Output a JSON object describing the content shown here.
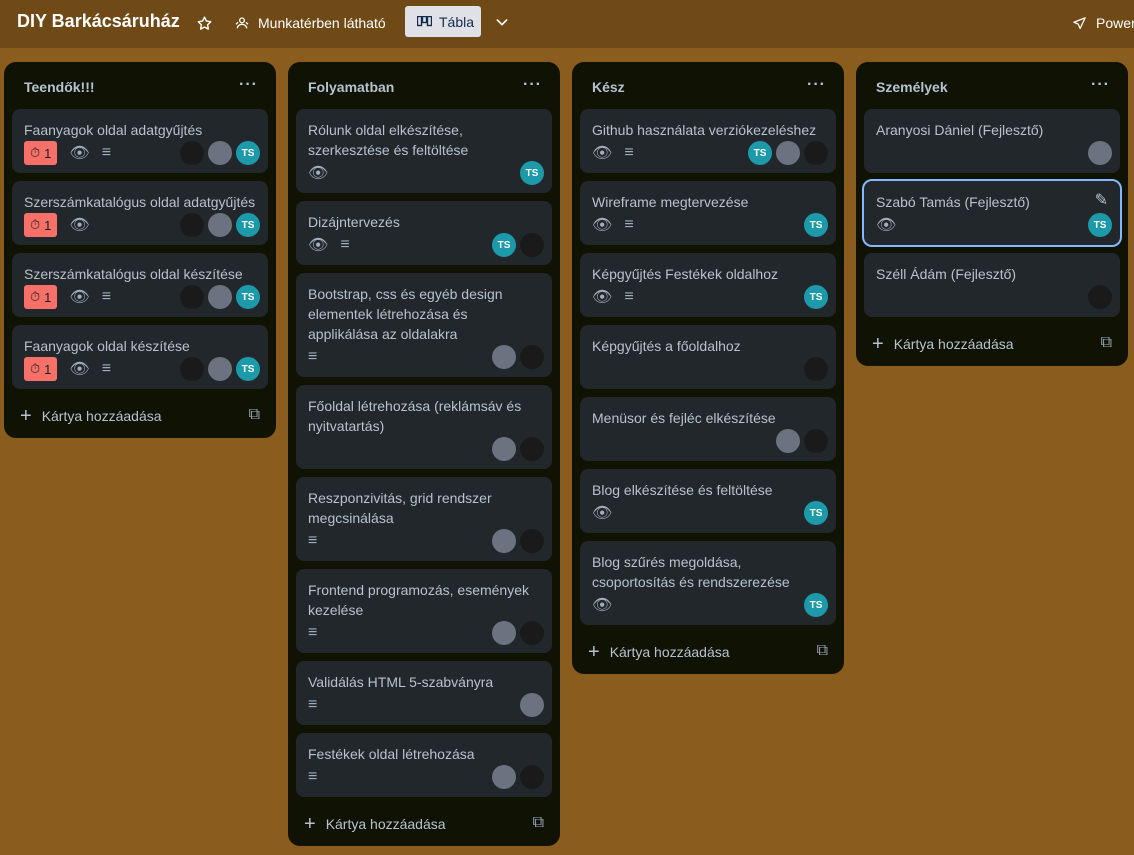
{
  "board": {
    "title": "DIY Barkácsáruház",
    "visibility": "Munkatérben látható",
    "view": "Tábla",
    "power": "Power",
    "icons": [
      "star-icon",
      "people-icon",
      "board-icon",
      "chevron-down-icon",
      "rocket-icon"
    ]
  },
  "colors": {
    "header": "#6f4a16",
    "background": "#8a5d1e",
    "list": "#101204",
    "card": "#22272b",
    "due_badge": "#f87168",
    "avatar_ts": "#1d9aaa"
  },
  "add_card_label": "Kártya hozzáadása",
  "lists": [
    {
      "title": "Teendők!!!",
      "cards": [
        {
          "title": "Faanyagok oldal adatgyűjtés",
          "due": "1"
        },
        {
          "title": "Szerszámkatalógus oldal adatgyűjtés",
          "due": "1"
        },
        {
          "title": "Szerszámkatalógus oldal készítése",
          "due": "1"
        },
        {
          "title": "Faanyagok oldal készítése",
          "due": "1"
        }
      ]
    },
    {
      "title": "Folyamatban",
      "cards": [
        {
          "title": "Rólunk oldal elkészítése, szerkesztése és feltöltése"
        },
        {
          "title": "Dizájntervezés"
        },
        {
          "title": "Bootstrap, css és egyéb design elementek létrehozása és applikálása az oldalakra"
        },
        {
          "title": "Főoldal létrehozása (reklámsáv és nyitvatartás)"
        },
        {
          "title": "Reszponzivitás, grid rendszer megcsinálása"
        },
        {
          "title": "Frontend programozás, események kezelése"
        },
        {
          "title": "Validálás HTML 5-szabványra"
        },
        {
          "title": "Festékek oldal létrehozása"
        }
      ]
    },
    {
      "title": "Kész",
      "cards": [
        {
          "title": "Github használata verziókezeléshez"
        },
        {
          "title": "Wireframe megtervezése"
        },
        {
          "title": "Képgyűjtés Festékek oldalhoz"
        },
        {
          "title": "Képgyűjtés a főoldalhoz"
        },
        {
          "title": "Menüsor és fejléc elkészítése"
        },
        {
          "title": "Blog elkészítése és feltöltése"
        },
        {
          "title": "Blog szűrés megoldása, csoportosítás és rendszerezése"
        }
      ]
    },
    {
      "title": "Személyek",
      "cards": [
        {
          "title": "Aranyosi Dániel (Fejlesztő)"
        },
        {
          "title": "Szabó Tamás (Fejlesztő)"
        },
        {
          "title": "Széll Ádám (Fejlesztő)"
        }
      ]
    }
  ],
  "member_initials": "TS"
}
